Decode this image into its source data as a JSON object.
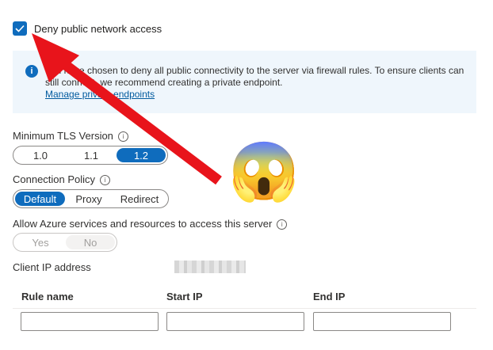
{
  "deny_public": {
    "checked": true,
    "label": "Deny public network access"
  },
  "info": {
    "icon": "info-icon",
    "text": "You have chosen to deny all public connectivity to the server via firewall rules. To ensure clients can still connect, we recommend creating a private endpoint.",
    "link": "Manage private endpoints"
  },
  "tls": {
    "label": "Minimum TLS Version",
    "options": [
      "1.0",
      "1.1",
      "1.2"
    ],
    "selected": "1.2"
  },
  "connection_policy": {
    "label": "Connection Policy",
    "options": [
      "Default",
      "Proxy",
      "Redirect"
    ],
    "selected": "Default"
  },
  "azure_services": {
    "label": "Allow Azure services and resources to access this server",
    "options": [
      "Yes",
      "No"
    ],
    "selected": "No",
    "disabled": true
  },
  "client_ip": {
    "label": "Client IP address"
  },
  "rules_table": {
    "columns": [
      "Rule name",
      "Start IP",
      "End IP"
    ]
  },
  "annotations": {
    "arrow_color": "#e8141b",
    "emoji": "😱"
  }
}
